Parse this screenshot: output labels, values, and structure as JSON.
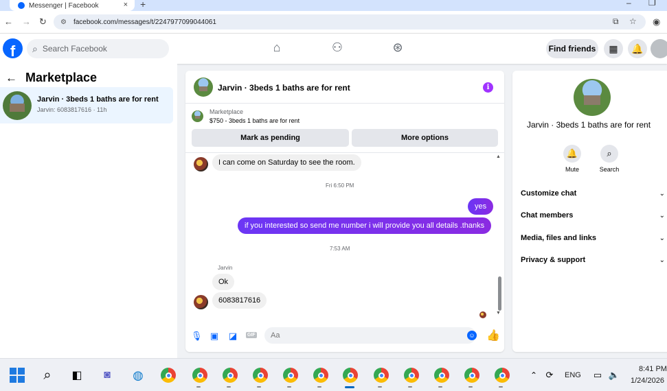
{
  "browser": {
    "tab_title": "Messenger | Facebook",
    "new_tab": "+",
    "url": "facebook.com/messages/t/2247977099044061"
  },
  "header": {
    "search_placeholder": "Search Facebook",
    "find_friends": "Find friends"
  },
  "sidebar": {
    "title": "Marketplace",
    "conversations": [
      {
        "name": "Jarvin · 3beds 1 baths are for rent",
        "preview": "Jarvin: 6083817616 · 11h"
      }
    ]
  },
  "chat": {
    "title": "Jarvin · 3beds 1 baths are for rent",
    "marketplace_label": "Marketplace",
    "listing": "$750 - 3beds 1 baths are for rent",
    "mark_pending": "Mark as pending",
    "more_options": "More options",
    "messages": [
      {
        "from": "them",
        "text": "I can come on Saturday to see the room."
      },
      {
        "type": "time",
        "text": "Fri 6:50 PM"
      },
      {
        "from": "me",
        "text": "yes"
      },
      {
        "from": "me",
        "text": "if you interested so send me number i will provide you all details .thanks"
      },
      {
        "type": "time",
        "text": "7:53 AM"
      },
      {
        "type": "sender",
        "text": "Jarvin"
      },
      {
        "from": "them",
        "text": "Ok"
      },
      {
        "from": "them",
        "text": "6083817616"
      }
    ],
    "composer_placeholder": "Aa",
    "gif_label": "GIF"
  },
  "details": {
    "name": "Jarvin · 3beds 1 baths are for rent",
    "mute": "Mute",
    "search": "Search",
    "sections": [
      "Customize chat",
      "Chat members",
      "Media, files and links",
      "Privacy & support"
    ]
  },
  "taskbar": {
    "language": "ENG",
    "time": "8:41 PM",
    "date": "1/24/2026"
  },
  "colors": {
    "facebook_blue": "#0866ff",
    "outgoing_bubble": "#7a2ef4",
    "selected_conversation": "#ebf5ff"
  }
}
